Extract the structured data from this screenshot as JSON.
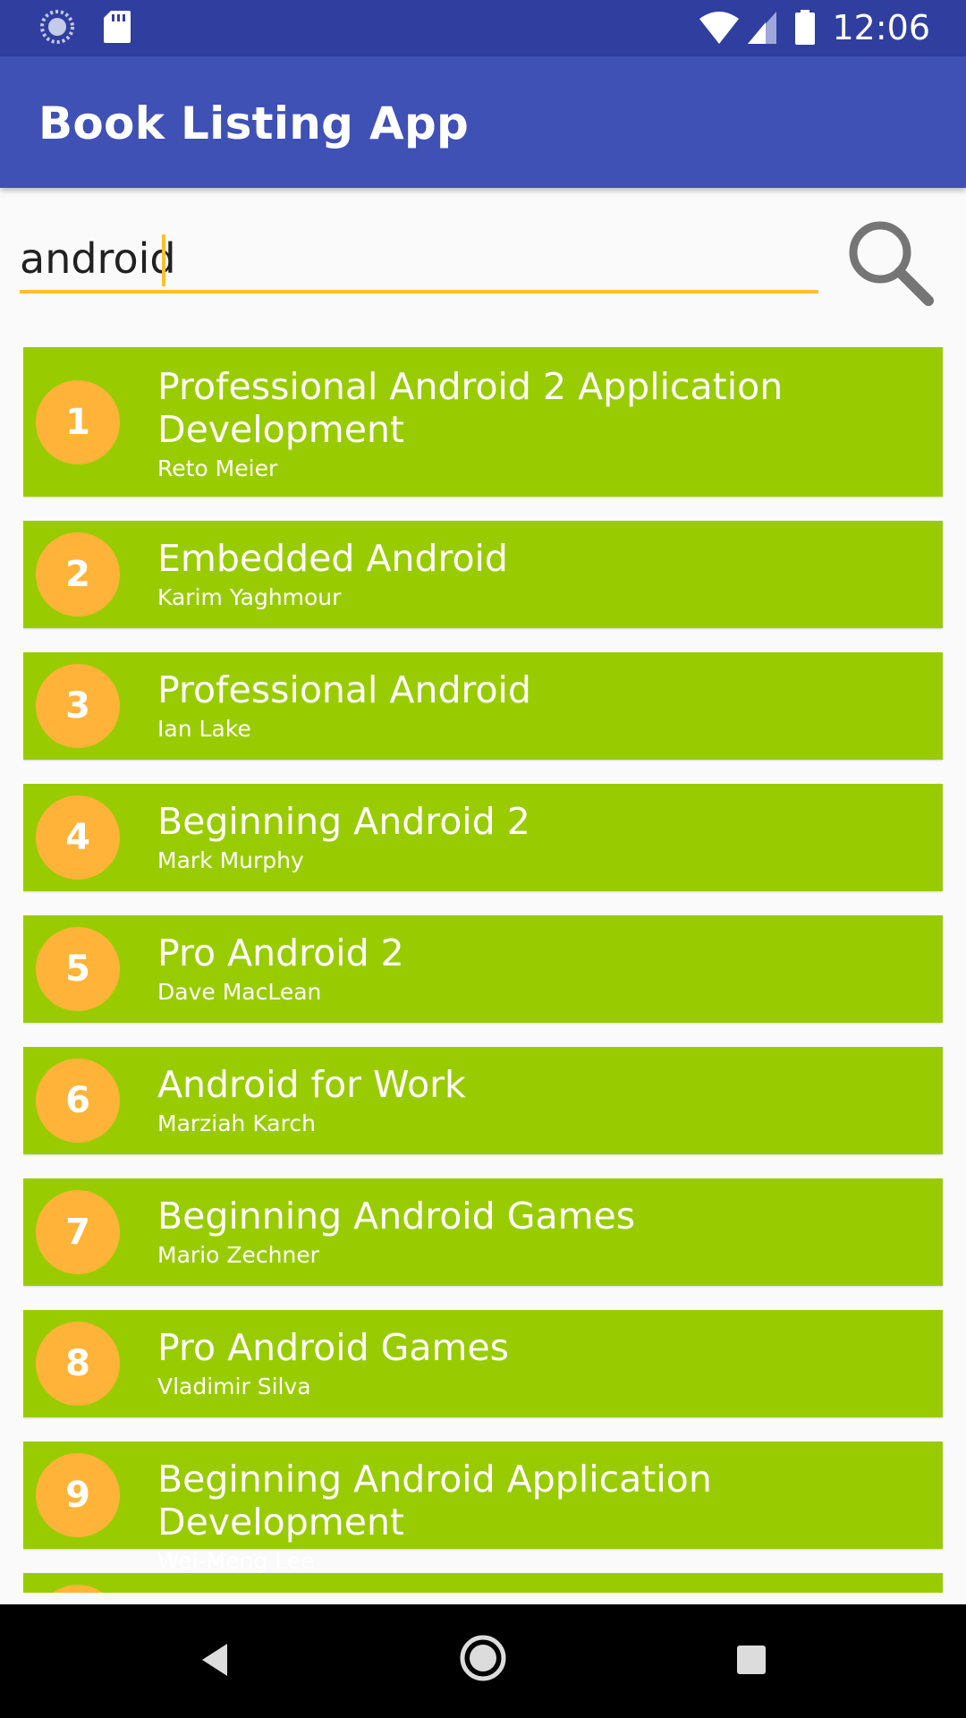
{
  "status_bar": {
    "time": "12:06",
    "icons": [
      "sync-icon",
      "sd-card-icon",
      "wifi-icon",
      "signal-icon",
      "battery-icon"
    ]
  },
  "app_bar": {
    "title": "Book Listing App"
  },
  "search": {
    "value": "android",
    "placeholder": ""
  },
  "colors": {
    "primary": "#3f51b5",
    "primary_dark": "#303f9f",
    "item_bg": "#99cc00",
    "badge": "#ffb338",
    "accent": "#fbc02d"
  },
  "books": [
    {
      "rank": "1",
      "title": "Professional Android 2 Application Development",
      "author": "Reto Meier"
    },
    {
      "rank": "2",
      "title": "Embedded Android",
      "author": "Karim Yaghmour"
    },
    {
      "rank": "3",
      "title": "Professional Android",
      "author": "Ian Lake"
    },
    {
      "rank": "4",
      "title": "Beginning Android 2",
      "author": "Mark Murphy"
    },
    {
      "rank": "5",
      "title": "Pro Android 2",
      "author": "Dave MacLean"
    },
    {
      "rank": "6",
      "title": "Android for Work",
      "author": "Marziah Karch"
    },
    {
      "rank": "7",
      "title": "Beginning Android Games",
      "author": "Mario Zechner"
    },
    {
      "rank": "8",
      "title": "Pro Android Games",
      "author": "Vladimir Silva"
    },
    {
      "rank": "9",
      "title": "Beginning Android Application Development",
      "author": "Wei-Meng Lee"
    }
  ],
  "nav_bar": {
    "buttons": [
      "back-icon",
      "home-icon",
      "recents-icon"
    ]
  }
}
